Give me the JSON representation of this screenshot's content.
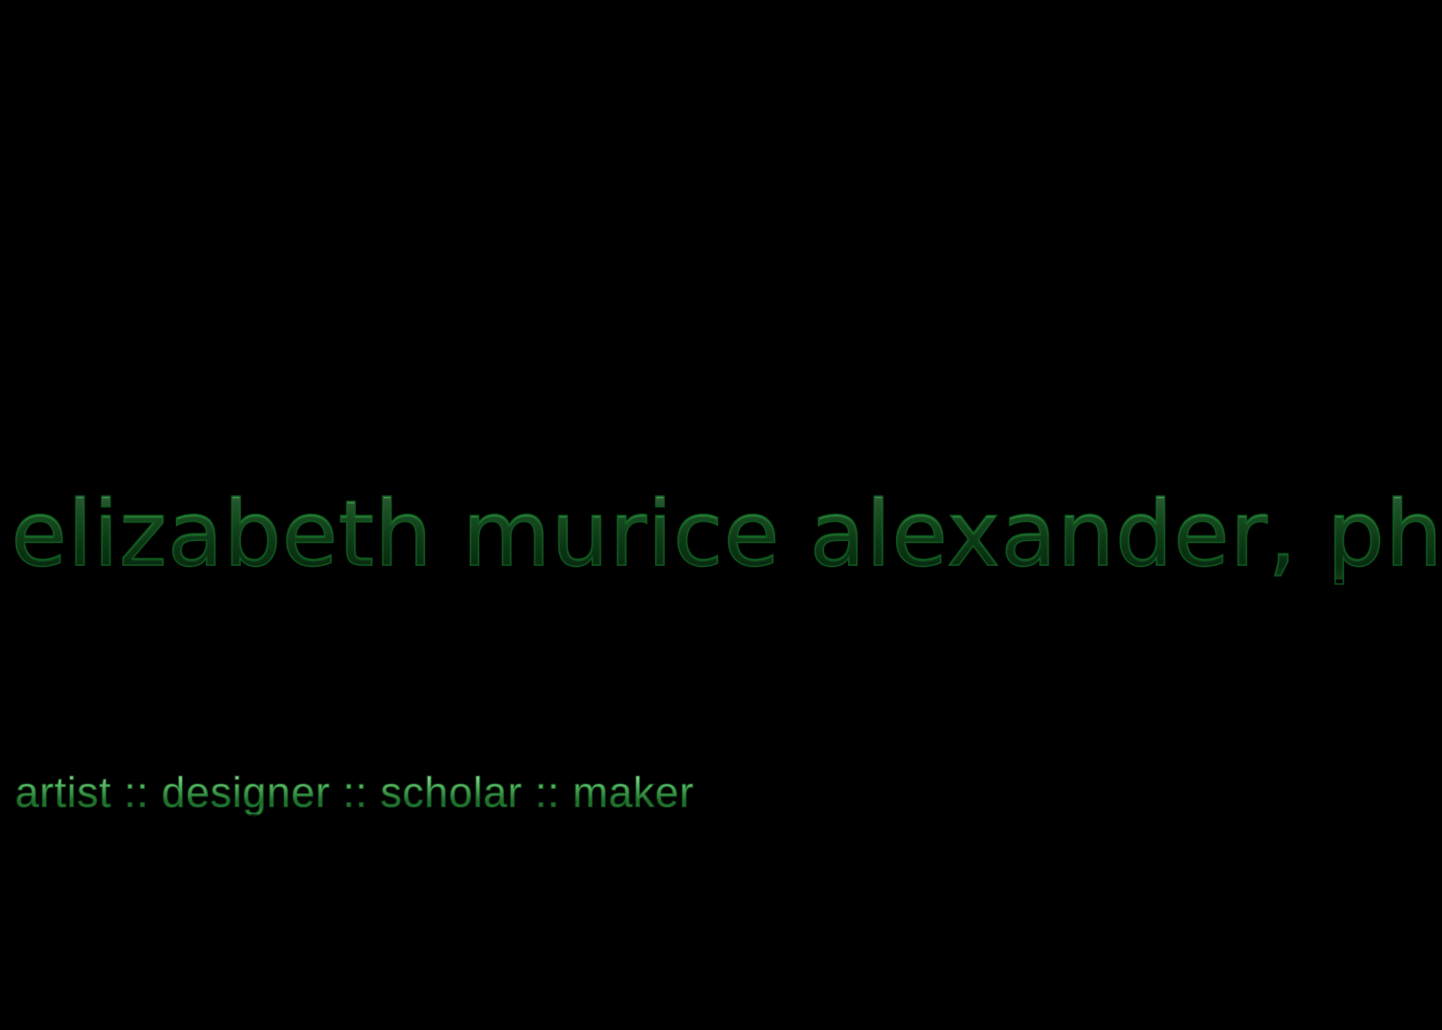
{
  "header": {
    "name": "elizabeth murice alexander, phd",
    "tagline": "artist :: designer :: scholar :: maker"
  },
  "colors": {
    "background": "#000000",
    "accent": "#2a9a3e"
  }
}
